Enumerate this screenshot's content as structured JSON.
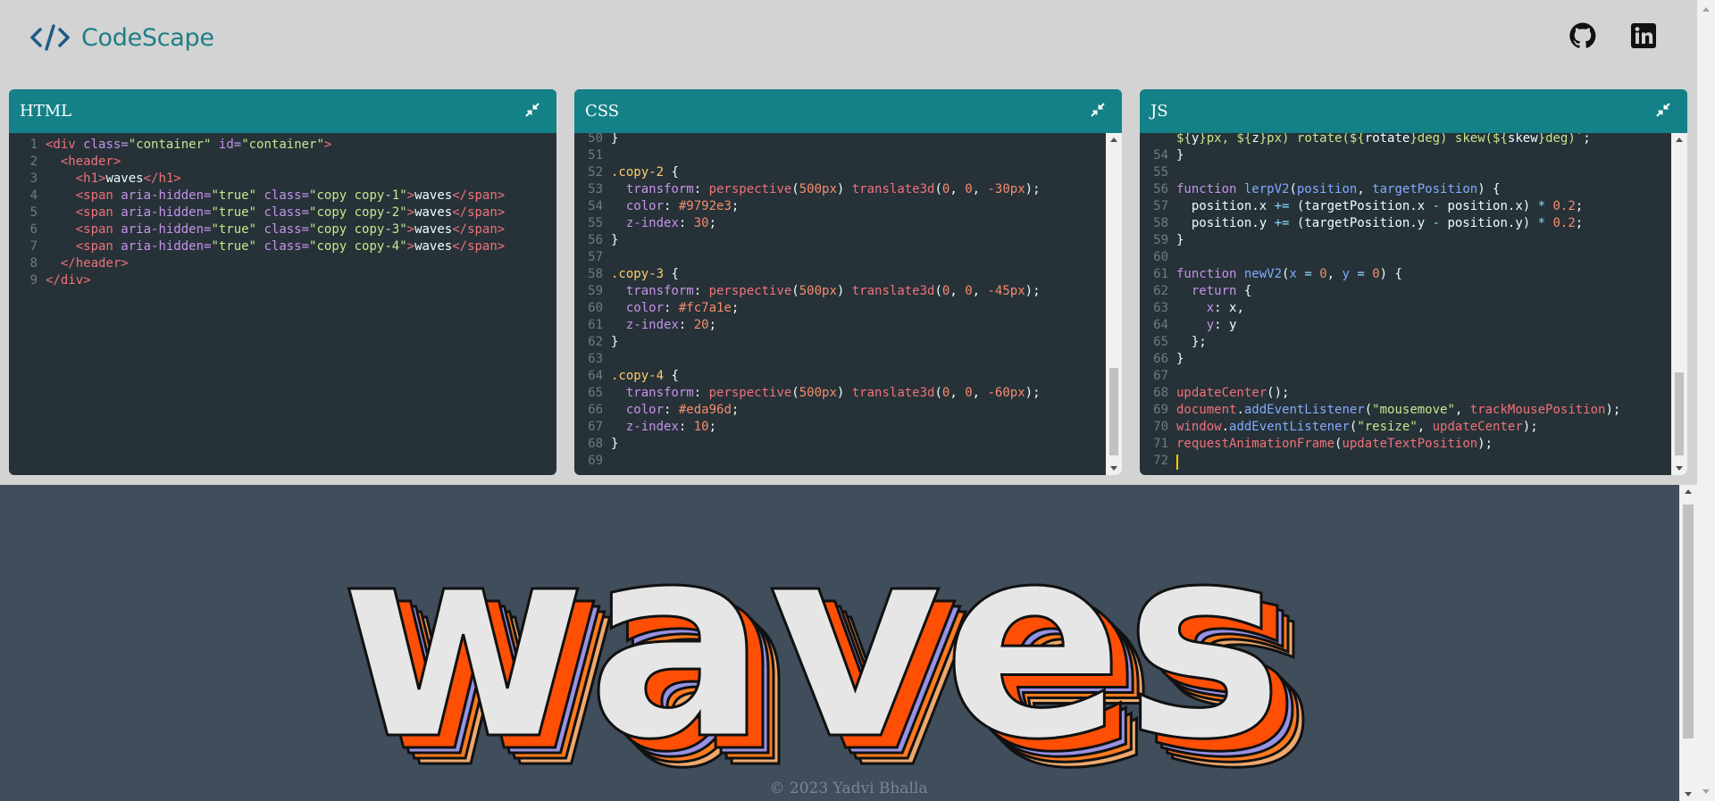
{
  "app": {
    "title": "CodeScape"
  },
  "header": {
    "github_label": "github-icon",
    "linkedin_label": "linkedin-icon"
  },
  "panels": [
    {
      "title": "HTML"
    },
    {
      "title": "CSS"
    },
    {
      "title": "JS"
    }
  ],
  "html_code": [
    {
      "n": "1",
      "segs": [
        [
          "tag",
          "<div "
        ],
        [
          "attr",
          "class="
        ],
        [
          "str",
          "\"container\" "
        ],
        [
          "attr",
          "id="
        ],
        [
          "str",
          "\"container\""
        ],
        [
          "tag",
          ">"
        ]
      ]
    },
    {
      "n": "2",
      "segs": [
        [
          "plain",
          "  "
        ],
        [
          "tag",
          "<header>"
        ]
      ]
    },
    {
      "n": "3",
      "segs": [
        [
          "plain",
          "    "
        ],
        [
          "tag",
          "<h1>"
        ],
        [
          "plain",
          "waves"
        ],
        [
          "tag",
          "</h1>"
        ]
      ]
    },
    {
      "n": "4",
      "segs": [
        [
          "plain",
          "    "
        ],
        [
          "tag",
          "<span "
        ],
        [
          "attr",
          "aria-hidden="
        ],
        [
          "str",
          "\"true\" "
        ],
        [
          "attr",
          "class="
        ],
        [
          "str",
          "\"copy copy-1\""
        ],
        [
          "tag",
          ">"
        ],
        [
          "plain",
          "waves"
        ],
        [
          "tag",
          "</span>"
        ]
      ]
    },
    {
      "n": "5",
      "segs": [
        [
          "plain",
          "    "
        ],
        [
          "tag",
          "<span "
        ],
        [
          "attr",
          "aria-hidden="
        ],
        [
          "str",
          "\"true\" "
        ],
        [
          "attr",
          "class="
        ],
        [
          "str",
          "\"copy copy-2\""
        ],
        [
          "tag",
          ">"
        ],
        [
          "plain",
          "waves"
        ],
        [
          "tag",
          "</span>"
        ]
      ]
    },
    {
      "n": "6",
      "segs": [
        [
          "plain",
          "    "
        ],
        [
          "tag",
          "<span "
        ],
        [
          "attr",
          "aria-hidden="
        ],
        [
          "str",
          "\"true\" "
        ],
        [
          "attr",
          "class="
        ],
        [
          "str",
          "\"copy copy-3\""
        ],
        [
          "tag",
          ">"
        ],
        [
          "plain",
          "waves"
        ],
        [
          "tag",
          "</span>"
        ]
      ]
    },
    {
      "n": "7",
      "segs": [
        [
          "plain",
          "    "
        ],
        [
          "tag",
          "<span "
        ],
        [
          "attr",
          "aria-hidden="
        ],
        [
          "str",
          "\"true\" "
        ],
        [
          "attr",
          "class="
        ],
        [
          "str",
          "\"copy copy-4\""
        ],
        [
          "tag",
          ">"
        ],
        [
          "plain",
          "waves"
        ],
        [
          "tag",
          "</span>"
        ]
      ]
    },
    {
      "n": "8",
      "segs": [
        [
          "plain",
          "  "
        ],
        [
          "tag",
          "</header>"
        ]
      ]
    },
    {
      "n": "9",
      "segs": [
        [
          "tag",
          "</div>"
        ]
      ]
    }
  ],
  "css_code": [
    {
      "n": "50",
      "segs": [
        [
          "plain",
          "}"
        ]
      ]
    },
    {
      "n": "51",
      "segs": []
    },
    {
      "n": "52",
      "segs": [
        [
          "sel",
          ".copy-2 "
        ],
        [
          "plain",
          "{"
        ]
      ]
    },
    {
      "n": "53",
      "segs": [
        [
          "plain",
          "  "
        ],
        [
          "prop",
          "transform"
        ],
        [
          "plain",
          ": "
        ],
        [
          "var",
          "perspective"
        ],
        [
          "plain",
          "("
        ],
        [
          "num",
          "500px"
        ],
        [
          "plain",
          ") "
        ],
        [
          "var",
          "translate3d"
        ],
        [
          "plain",
          "("
        ],
        [
          "num",
          "0"
        ],
        [
          "plain",
          ", "
        ],
        [
          "num",
          "0"
        ],
        [
          "plain",
          ", "
        ],
        [
          "num",
          "-30px"
        ],
        [
          "plain",
          ");"
        ]
      ]
    },
    {
      "n": "54",
      "segs": [
        [
          "plain",
          "  "
        ],
        [
          "prop",
          "color"
        ],
        [
          "plain",
          ": "
        ],
        [
          "num",
          "#9792e3"
        ],
        [
          "plain",
          ";"
        ]
      ]
    },
    {
      "n": "55",
      "segs": [
        [
          "plain",
          "  "
        ],
        [
          "prop",
          "z-index"
        ],
        [
          "plain",
          ": "
        ],
        [
          "num",
          "30"
        ],
        [
          "plain",
          ";"
        ]
      ]
    },
    {
      "n": "56",
      "segs": [
        [
          "plain",
          "}"
        ]
      ]
    },
    {
      "n": "57",
      "segs": []
    },
    {
      "n": "58",
      "segs": [
        [
          "sel",
          ".copy-3 "
        ],
        [
          "plain",
          "{"
        ]
      ]
    },
    {
      "n": "59",
      "segs": [
        [
          "plain",
          "  "
        ],
        [
          "prop",
          "transform"
        ],
        [
          "plain",
          ": "
        ],
        [
          "var",
          "perspective"
        ],
        [
          "plain",
          "("
        ],
        [
          "num",
          "500px"
        ],
        [
          "plain",
          ") "
        ],
        [
          "var",
          "translate3d"
        ],
        [
          "plain",
          "("
        ],
        [
          "num",
          "0"
        ],
        [
          "plain",
          ", "
        ],
        [
          "num",
          "0"
        ],
        [
          "plain",
          ", "
        ],
        [
          "num",
          "-45px"
        ],
        [
          "plain",
          ");"
        ]
      ]
    },
    {
      "n": "60",
      "segs": [
        [
          "plain",
          "  "
        ],
        [
          "prop",
          "color"
        ],
        [
          "plain",
          ": "
        ],
        [
          "num",
          "#fc7a1e"
        ],
        [
          "plain",
          ";"
        ]
      ]
    },
    {
      "n": "61",
      "segs": [
        [
          "plain",
          "  "
        ],
        [
          "prop",
          "z-index"
        ],
        [
          "plain",
          ": "
        ],
        [
          "num",
          "20"
        ],
        [
          "plain",
          ";"
        ]
      ]
    },
    {
      "n": "62",
      "segs": [
        [
          "plain",
          "}"
        ]
      ]
    },
    {
      "n": "63",
      "segs": []
    },
    {
      "n": "64",
      "segs": [
        [
          "sel",
          ".copy-4 "
        ],
        [
          "plain",
          "{"
        ]
      ]
    },
    {
      "n": "65",
      "segs": [
        [
          "plain",
          "  "
        ],
        [
          "prop",
          "transform"
        ],
        [
          "plain",
          ": "
        ],
        [
          "var",
          "perspective"
        ],
        [
          "plain",
          "("
        ],
        [
          "num",
          "500px"
        ],
        [
          "plain",
          ") "
        ],
        [
          "var",
          "translate3d"
        ],
        [
          "plain",
          "("
        ],
        [
          "num",
          "0"
        ],
        [
          "plain",
          ", "
        ],
        [
          "num",
          "0"
        ],
        [
          "plain",
          ", "
        ],
        [
          "num",
          "-60px"
        ],
        [
          "plain",
          ");"
        ]
      ]
    },
    {
      "n": "66",
      "segs": [
        [
          "plain",
          "  "
        ],
        [
          "prop",
          "color"
        ],
        [
          "plain",
          ": "
        ],
        [
          "num",
          "#eda96d"
        ],
        [
          "plain",
          ";"
        ]
      ]
    },
    {
      "n": "67",
      "segs": [
        [
          "plain",
          "  "
        ],
        [
          "prop",
          "z-index"
        ],
        [
          "plain",
          ": "
        ],
        [
          "num",
          "10"
        ],
        [
          "plain",
          ";"
        ]
      ]
    },
    {
      "n": "68",
      "segs": [
        [
          "plain",
          "}"
        ]
      ]
    },
    {
      "n": "69",
      "segs": []
    }
  ],
  "js_code": [
    {
      "n": "",
      "segs": [
        [
          "str2",
          "${"
        ],
        [
          "plain",
          "y"
        ],
        [
          "str2",
          "}px, ${"
        ],
        [
          "plain",
          "z"
        ],
        [
          "str2",
          "}px) rotate(${"
        ],
        [
          "plain",
          "rotate"
        ],
        [
          "str2",
          "}deg) skew(${"
        ],
        [
          "plain",
          "skew"
        ],
        [
          "str2",
          "}deg)`"
        ],
        [
          "plain",
          ";"
        ]
      ]
    },
    {
      "n": "54",
      "segs": [
        [
          "plain",
          "}"
        ]
      ]
    },
    {
      "n": "55",
      "segs": []
    },
    {
      "n": "56",
      "segs": [
        [
          "kw",
          "function "
        ],
        [
          "fn",
          "lerpV2"
        ],
        [
          "plain",
          "("
        ],
        [
          "fn",
          "position"
        ],
        [
          "plain",
          ", "
        ],
        [
          "fn",
          "targetPosition"
        ],
        [
          "plain",
          ") {"
        ]
      ]
    },
    {
      "n": "57",
      "segs": [
        [
          "plain",
          "  position."
        ],
        [
          "plain",
          "x "
        ],
        [
          "op",
          "+= "
        ],
        [
          "plain",
          "(targetPosition."
        ],
        [
          "plain",
          "x "
        ],
        [
          "op",
          "- "
        ],
        [
          "plain",
          "position."
        ],
        [
          "plain",
          "x) "
        ],
        [
          "op",
          "* "
        ],
        [
          "num",
          "0.2"
        ],
        [
          "plain",
          ";"
        ]
      ]
    },
    {
      "n": "58",
      "segs": [
        [
          "plain",
          "  position."
        ],
        [
          "plain",
          "y "
        ],
        [
          "op",
          "+= "
        ],
        [
          "plain",
          "(targetPosition."
        ],
        [
          "plain",
          "y "
        ],
        [
          "op",
          "- "
        ],
        [
          "plain",
          "position."
        ],
        [
          "plain",
          "y) "
        ],
        [
          "op",
          "* "
        ],
        [
          "num",
          "0.2"
        ],
        [
          "plain",
          ";"
        ]
      ]
    },
    {
      "n": "59",
      "segs": [
        [
          "plain",
          "}"
        ]
      ]
    },
    {
      "n": "60",
      "segs": []
    },
    {
      "n": "61",
      "segs": [
        [
          "kw",
          "function "
        ],
        [
          "fn",
          "newV2"
        ],
        [
          "plain",
          "("
        ],
        [
          "fn",
          "x"
        ],
        [
          "op",
          " = "
        ],
        [
          "num",
          "0"
        ],
        [
          "plain",
          ", "
        ],
        [
          "fn",
          "y"
        ],
        [
          "op",
          " = "
        ],
        [
          "num",
          "0"
        ],
        [
          "plain",
          ") {"
        ]
      ]
    },
    {
      "n": "62",
      "segs": [
        [
          "plain",
          "  "
        ],
        [
          "kw",
          "return "
        ],
        [
          "plain",
          "{"
        ]
      ]
    },
    {
      "n": "63",
      "segs": [
        [
          "plain",
          "    "
        ],
        [
          "prop",
          "x"
        ],
        [
          "plain",
          ": x,"
        ]
      ]
    },
    {
      "n": "64",
      "segs": [
        [
          "plain",
          "    "
        ],
        [
          "prop",
          "y"
        ],
        [
          "plain",
          ": y"
        ]
      ]
    },
    {
      "n": "65",
      "segs": [
        [
          "plain",
          "  };"
        ]
      ]
    },
    {
      "n": "66",
      "segs": [
        [
          "plain",
          "}"
        ]
      ]
    },
    {
      "n": "67",
      "segs": []
    },
    {
      "n": "68",
      "segs": [
        [
          "var",
          "updateCenter"
        ],
        [
          "plain",
          "();"
        ]
      ]
    },
    {
      "n": "69",
      "segs": [
        [
          "var",
          "document"
        ],
        [
          "plain",
          "."
        ],
        [
          "fn",
          "addEventListener"
        ],
        [
          "plain",
          "("
        ],
        [
          "str",
          "\"mousemove\""
        ],
        [
          "plain",
          ", "
        ],
        [
          "var",
          "trackMousePosition"
        ],
        [
          "plain",
          ");"
        ]
      ]
    },
    {
      "n": "70",
      "segs": [
        [
          "var",
          "window"
        ],
        [
          "plain",
          "."
        ],
        [
          "fn",
          "addEventListener"
        ],
        [
          "plain",
          "("
        ],
        [
          "str",
          "\"resize\""
        ],
        [
          "plain",
          ", "
        ],
        [
          "var",
          "updateCenter"
        ],
        [
          "plain",
          ");"
        ]
      ]
    },
    {
      "n": "71",
      "segs": [
        [
          "var",
          "requestAnimationFrame"
        ],
        [
          "plain",
          "("
        ],
        [
          "var",
          "updateTextPosition"
        ],
        [
          "plain",
          ");"
        ]
      ]
    },
    {
      "n": "72",
      "segs": []
    }
  ],
  "preview": {
    "text": "waves"
  },
  "footer": {
    "text": "© 2023 Yadvi Bhalla"
  },
  "colors": {
    "accent": "#148188",
    "editor_bg": "#263238",
    "preview_bg": "#404d5b",
    "copy_1": "#ff4f05",
    "copy_2": "#9792e3",
    "copy_3": "#fc7a1e",
    "copy_4": "#eda96d"
  }
}
